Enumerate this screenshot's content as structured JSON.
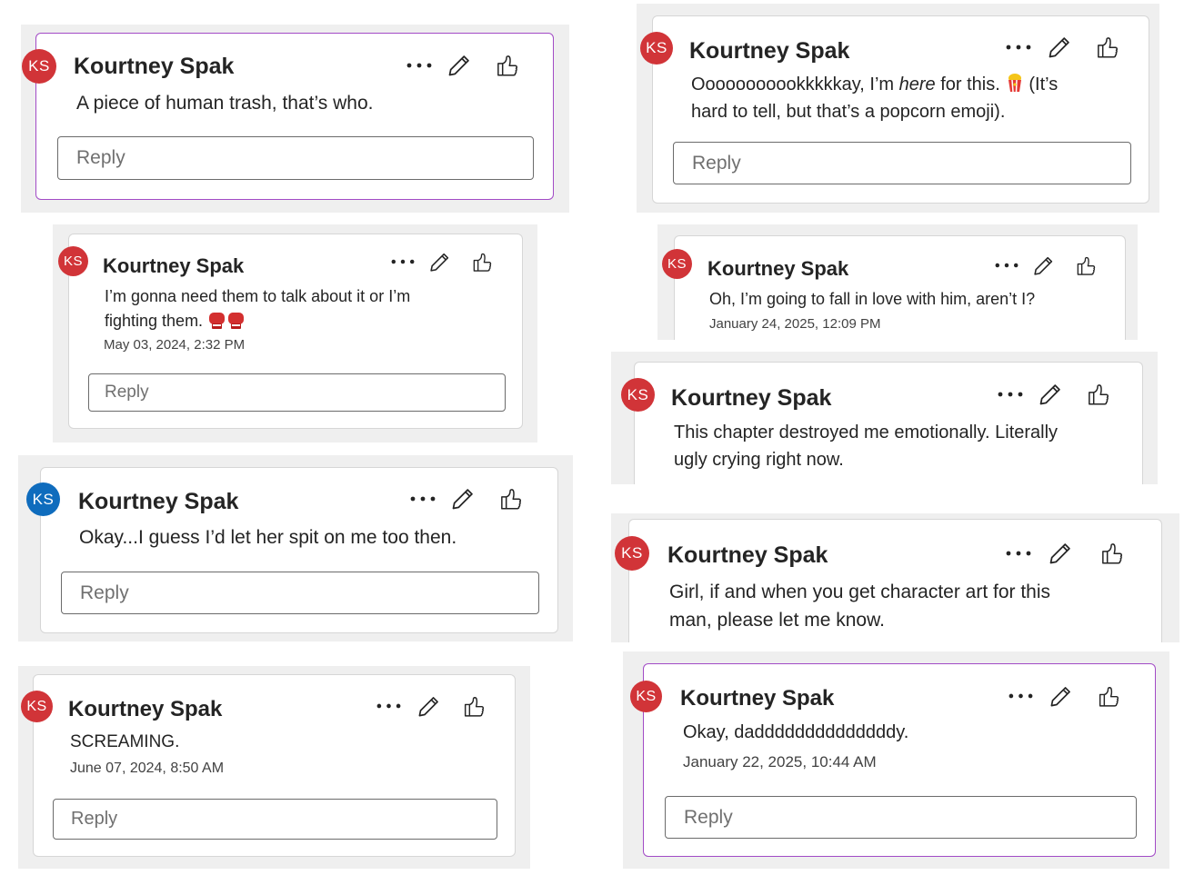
{
  "colors": {
    "accent_purple": "#a24bc6",
    "avatar_red": "#d13438",
    "avatar_blue": "#0f6cbd",
    "tile_gray": "#efefef"
  },
  "icons": [
    "more-options-icon",
    "edit-pencil-icon",
    "like-thumbs-up-icon"
  ],
  "comments": [
    {
      "avatar_initials": "KS",
      "author": "Kourtney Spak",
      "text_lines": [
        "A piece of human trash, that’s who."
      ],
      "reply_placeholder": "Reply"
    },
    {
      "avatar_initials": "KS",
      "author": "Kourtney Spak",
      "text_parts": [
        "Ooooooooookkkkkay, I’m ",
        "here",
        " for this. ",
        "(It’s"
      ],
      "text_line2": "hard to tell, but that’s a popcorn emoji).",
      "emoji": "popcorn",
      "reply_placeholder": "Reply"
    },
    {
      "avatar_initials": "KS",
      "author": "Kourtney Spak",
      "text_lines": [
        "I’m gonna need them to talk about it or I’m",
        "fighting them."
      ],
      "emoji": "boxing-gloves",
      "timestamp": "May 03, 2024, 2:32 PM",
      "reply_placeholder": "Reply"
    },
    {
      "avatar_initials": "KS",
      "author": "Kourtney Spak",
      "text_lines": [
        "Oh, I’m going to fall in love with him, aren’t I?"
      ],
      "timestamp": "January 24, 2025, 12:09 PM"
    },
    {
      "avatar_initials": "KS",
      "author": "Kourtney Spak",
      "text_lines": [
        "This chapter destroyed me emotionally. Literally",
        "ugly crying right now."
      ]
    },
    {
      "avatar_initials": "KS",
      "author": "Kourtney Spak",
      "text_lines": [
        "Okay...I guess I’d let her spit on me too then."
      ],
      "reply_placeholder": "Reply"
    },
    {
      "avatar_initials": "KS",
      "author": "Kourtney Spak",
      "text_lines": [
        "Girl, if and when you get character art for this",
        "man, please let me know."
      ]
    },
    {
      "avatar_initials": "KS",
      "author": "Kourtney Spak",
      "text_lines": [
        "SCREAMING."
      ],
      "timestamp": "June 07, 2024, 8:50 AM",
      "reply_placeholder": "Reply"
    },
    {
      "avatar_initials": "KS",
      "author": "Kourtney Spak",
      "text_lines": [
        "Okay, daddddddddddddddy."
      ],
      "timestamp": "January 22, 2025, 10:44 AM",
      "reply_placeholder": "Reply"
    }
  ]
}
